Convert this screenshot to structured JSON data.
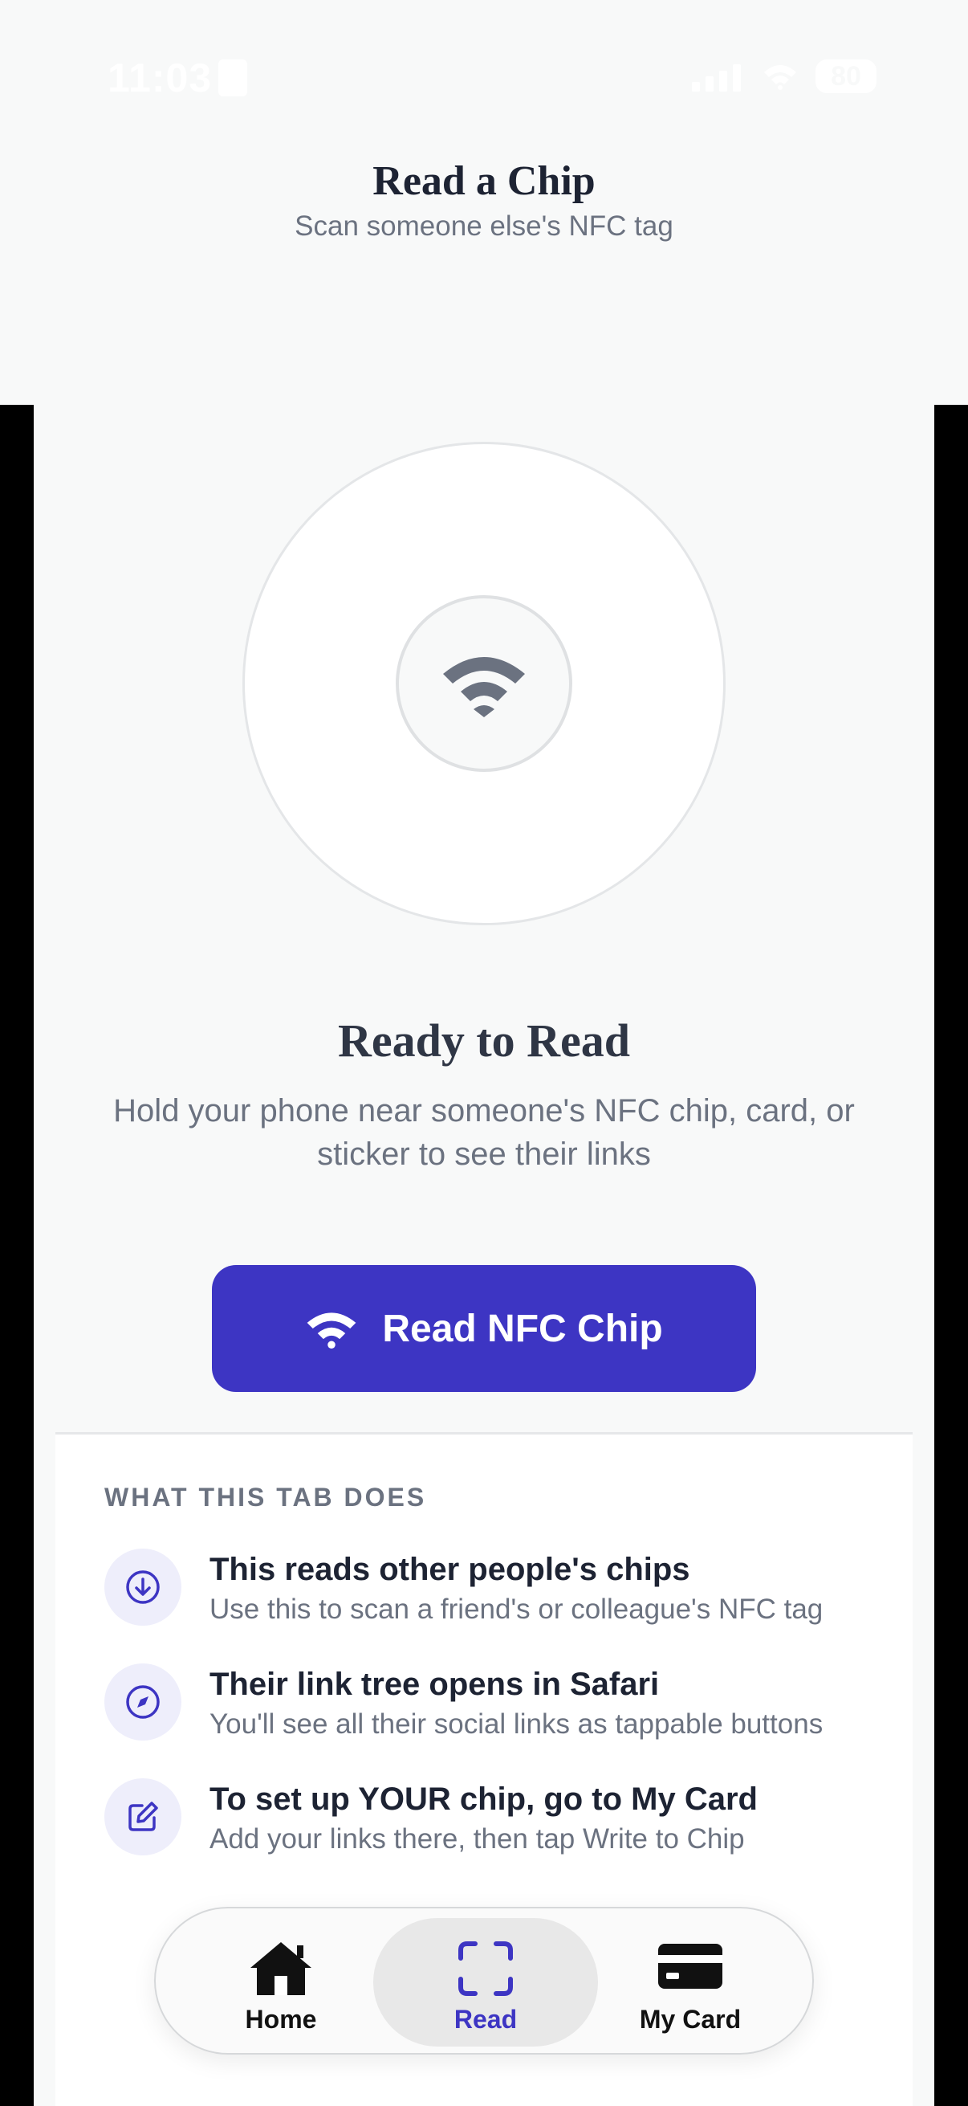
{
  "status_bar": {
    "time": "11:03",
    "battery": "80"
  },
  "header": {
    "title": "Read a Chip",
    "subtitle": "Scan someone else's NFC tag"
  },
  "scanner": {
    "icon": "wifi-icon",
    "status_title": "Ready to Read",
    "status_description": "Hold your phone near someone's NFC chip, card, or sticker to see their links"
  },
  "read_button": {
    "label": "Read NFC Chip",
    "icon": "wifi-icon"
  },
  "info": {
    "section_label": "WHAT THIS TAB DOES",
    "items": [
      {
        "icon": "arrow-down-circle-icon",
        "title": "This reads other people's chips",
        "subtitle": "Use this to scan a friend's or colleague's NFC tag"
      },
      {
        "icon": "compass-icon",
        "title": "Their link tree opens in Safari",
        "subtitle": "You'll see all their social links as tappable buttons"
      },
      {
        "icon": "edit-icon",
        "title": "To set up YOUR chip, go to My Card",
        "subtitle": "Add your links there, then tap Write to Chip"
      }
    ]
  },
  "tab_bar": {
    "tabs": [
      {
        "label": "Home",
        "icon": "home-icon",
        "active": false
      },
      {
        "label": "Read",
        "icon": "scan-icon",
        "active": true
      },
      {
        "label": "My Card",
        "icon": "card-icon",
        "active": false
      }
    ]
  },
  "colors": {
    "accent": "#3d35c3",
    "background": "#f8f9f9",
    "text_primary": "#1d2333",
    "text_secondary": "#6b7280"
  }
}
